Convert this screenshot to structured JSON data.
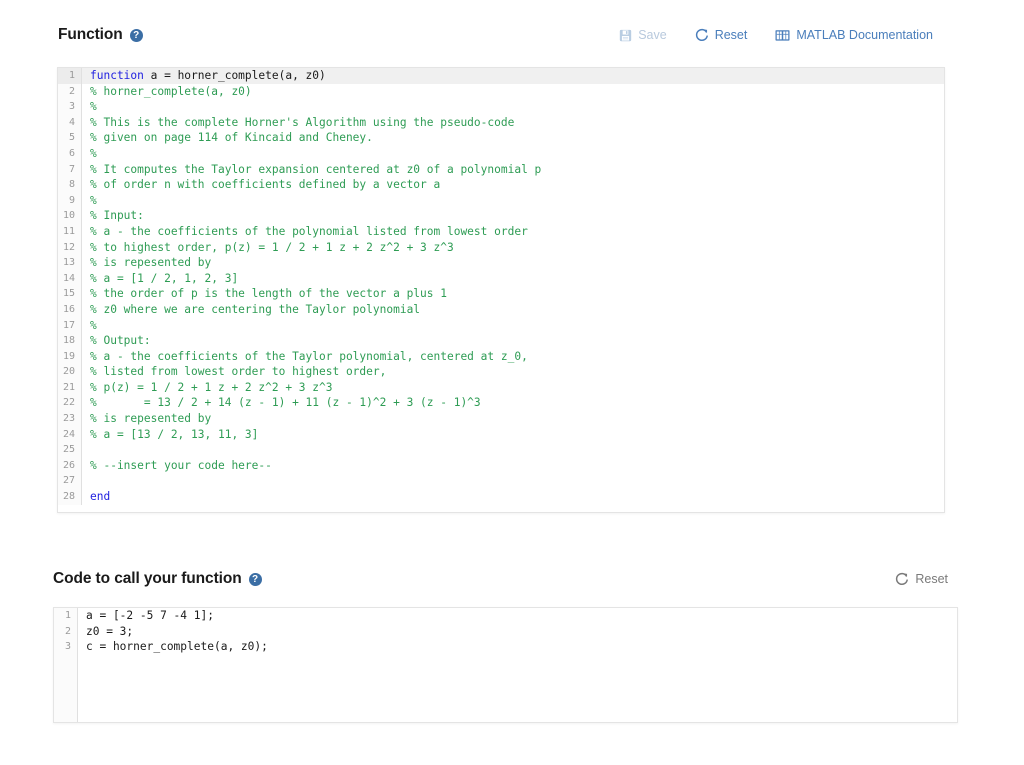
{
  "sections": [
    {
      "title": "Function",
      "help_icon": "help-circle-icon",
      "toolbar": [
        {
          "label": "Save",
          "icon": "save-floppy-icon",
          "state": "disabled"
        },
        {
          "label": "Reset",
          "icon": "reset-refresh-icon",
          "state": "enabled"
        },
        {
          "label": "MATLAB Documentation",
          "icon": "book-icon",
          "state": "enabled"
        }
      ],
      "editor": {
        "active_line": 1,
        "lines": [
          {
            "n": "1",
            "tokens": [
              {
                "t": "kw",
                "s": "function"
              },
              {
                "t": "pl",
                "s": " a = horner_complete(a, z0)"
              }
            ]
          },
          {
            "n": "2",
            "tokens": [
              {
                "t": "cm",
                "s": "% horner_complete(a, z0)"
              }
            ]
          },
          {
            "n": "3",
            "tokens": [
              {
                "t": "cm",
                "s": "%"
              }
            ]
          },
          {
            "n": "4",
            "tokens": [
              {
                "t": "cm",
                "s": "% This is the complete Horner's Algorithm using the pseudo-code"
              }
            ]
          },
          {
            "n": "5",
            "tokens": [
              {
                "t": "cm",
                "s": "% given on page 114 of Kincaid and Cheney."
              }
            ]
          },
          {
            "n": "6",
            "tokens": [
              {
                "t": "cm",
                "s": "%"
              }
            ]
          },
          {
            "n": "7",
            "tokens": [
              {
                "t": "cm",
                "s": "% It computes the Taylor expansion centered at z0 of a polynomial p"
              }
            ]
          },
          {
            "n": "8",
            "tokens": [
              {
                "t": "cm",
                "s": "% of order n with coefficients defined by a vector a"
              }
            ]
          },
          {
            "n": "9",
            "tokens": [
              {
                "t": "cm",
                "s": "%"
              }
            ]
          },
          {
            "n": "10",
            "tokens": [
              {
                "t": "cm",
                "s": "% Input:"
              }
            ]
          },
          {
            "n": "11",
            "tokens": [
              {
                "t": "cm",
                "s": "% a - the coefficients of the polynomial listed from lowest order"
              }
            ]
          },
          {
            "n": "12",
            "tokens": [
              {
                "t": "cm",
                "s": "% to highest order, p(z) = 1 / 2 + 1 z + 2 z^2 + 3 z^3"
              }
            ]
          },
          {
            "n": "13",
            "tokens": [
              {
                "t": "cm",
                "s": "% is repesented by"
              }
            ]
          },
          {
            "n": "14",
            "tokens": [
              {
                "t": "cm",
                "s": "% a = [1 / 2, 1, 2, 3]"
              }
            ]
          },
          {
            "n": "15",
            "tokens": [
              {
                "t": "cm",
                "s": "% the order of p is the length of the vector a plus 1"
              }
            ]
          },
          {
            "n": "16",
            "tokens": [
              {
                "t": "cm",
                "s": "% z0 where we are centering the Taylor polynomial"
              }
            ]
          },
          {
            "n": "17",
            "tokens": [
              {
                "t": "cm",
                "s": "%"
              }
            ]
          },
          {
            "n": "18",
            "tokens": [
              {
                "t": "cm",
                "s": "% Output:"
              }
            ]
          },
          {
            "n": "19",
            "tokens": [
              {
                "t": "cm",
                "s": "% a - the coefficients of the Taylor polynomial, centered at z_0,"
              }
            ]
          },
          {
            "n": "20",
            "tokens": [
              {
                "t": "cm",
                "s": "% listed from lowest order to highest order,"
              }
            ]
          },
          {
            "n": "21",
            "tokens": [
              {
                "t": "cm",
                "s": "% p(z) = 1 / 2 + 1 z + 2 z^2 + 3 z^3"
              }
            ]
          },
          {
            "n": "22",
            "tokens": [
              {
                "t": "cm",
                "s": "%       = 13 / 2 + 14 (z - 1) + 11 (z - 1)^2 + 3 (z - 1)^3"
              }
            ]
          },
          {
            "n": "23",
            "tokens": [
              {
                "t": "cm",
                "s": "% is repesented by"
              }
            ]
          },
          {
            "n": "24",
            "tokens": [
              {
                "t": "cm",
                "s": "% a = [13 / 2, 13, 11, 3]"
              }
            ]
          },
          {
            "n": "25",
            "tokens": [
              {
                "t": "pl",
                "s": ""
              }
            ]
          },
          {
            "n": "26",
            "tokens": [
              {
                "t": "cm",
                "s": "% --insert your code here--"
              }
            ]
          },
          {
            "n": "27",
            "tokens": [
              {
                "t": "pl",
                "s": ""
              }
            ]
          },
          {
            "n": "28",
            "tokens": [
              {
                "t": "kw",
                "s": "end"
              }
            ]
          }
        ]
      }
    },
    {
      "title": "Code to call your function",
      "help_icon": "help-circle-icon",
      "toolbar": [
        {
          "label": "Reset",
          "icon": "reset-refresh-icon",
          "state": "grey"
        }
      ],
      "editor": {
        "active_line": 0,
        "lines": [
          {
            "n": "1",
            "tokens": [
              {
                "t": "pl",
                "s": "a = [-2 -5 7 -4 1];"
              }
            ]
          },
          {
            "n": "2",
            "tokens": [
              {
                "t": "pl",
                "s": "z0 = 3;"
              }
            ]
          },
          {
            "n": "3",
            "tokens": [
              {
                "t": "pl",
                "s": "c = horner_complete(a, z0);"
              }
            ]
          }
        ]
      }
    }
  ],
  "colors": {
    "link_blue": "#4a7ebb",
    "disabled_blue": "#b8c9dd",
    "grey_text": "#7a7a7a",
    "keyword": "#2222e0",
    "comment": "#2e9c54",
    "help_badge": "#3b6ea5",
    "active_line": "#f0f0f0"
  }
}
